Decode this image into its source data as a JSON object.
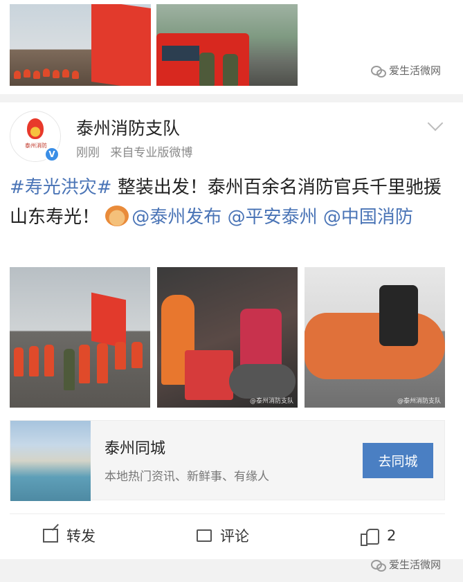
{
  "watermark": {
    "text": "爱生活微网"
  },
  "post": {
    "author": "泰州消防支队",
    "avatar_text": "泰州消防",
    "time": "刚刚",
    "source": "来自专业版微博",
    "topic": "#寿光洪灾#",
    "text1": "整装出发！泰州百余名消防官兵千里驰援山东寿光！",
    "mention1": "@泰州发布",
    "mention2": "@平安泰州",
    "mention3": "@中国消防",
    "verified_icon": "verified-v-icon",
    "photo_watermark": "@泰州消防支队"
  },
  "promo": {
    "title": "泰州同城",
    "subtitle": "本地热门资讯、新鲜事、有缘人",
    "button": "去同城"
  },
  "actions": {
    "share": "转发",
    "comment": "评论",
    "like": "2"
  },
  "colors": {
    "link": "#4a74b6",
    "button": "#4a7fc3",
    "verified": "#3a8ee6"
  }
}
